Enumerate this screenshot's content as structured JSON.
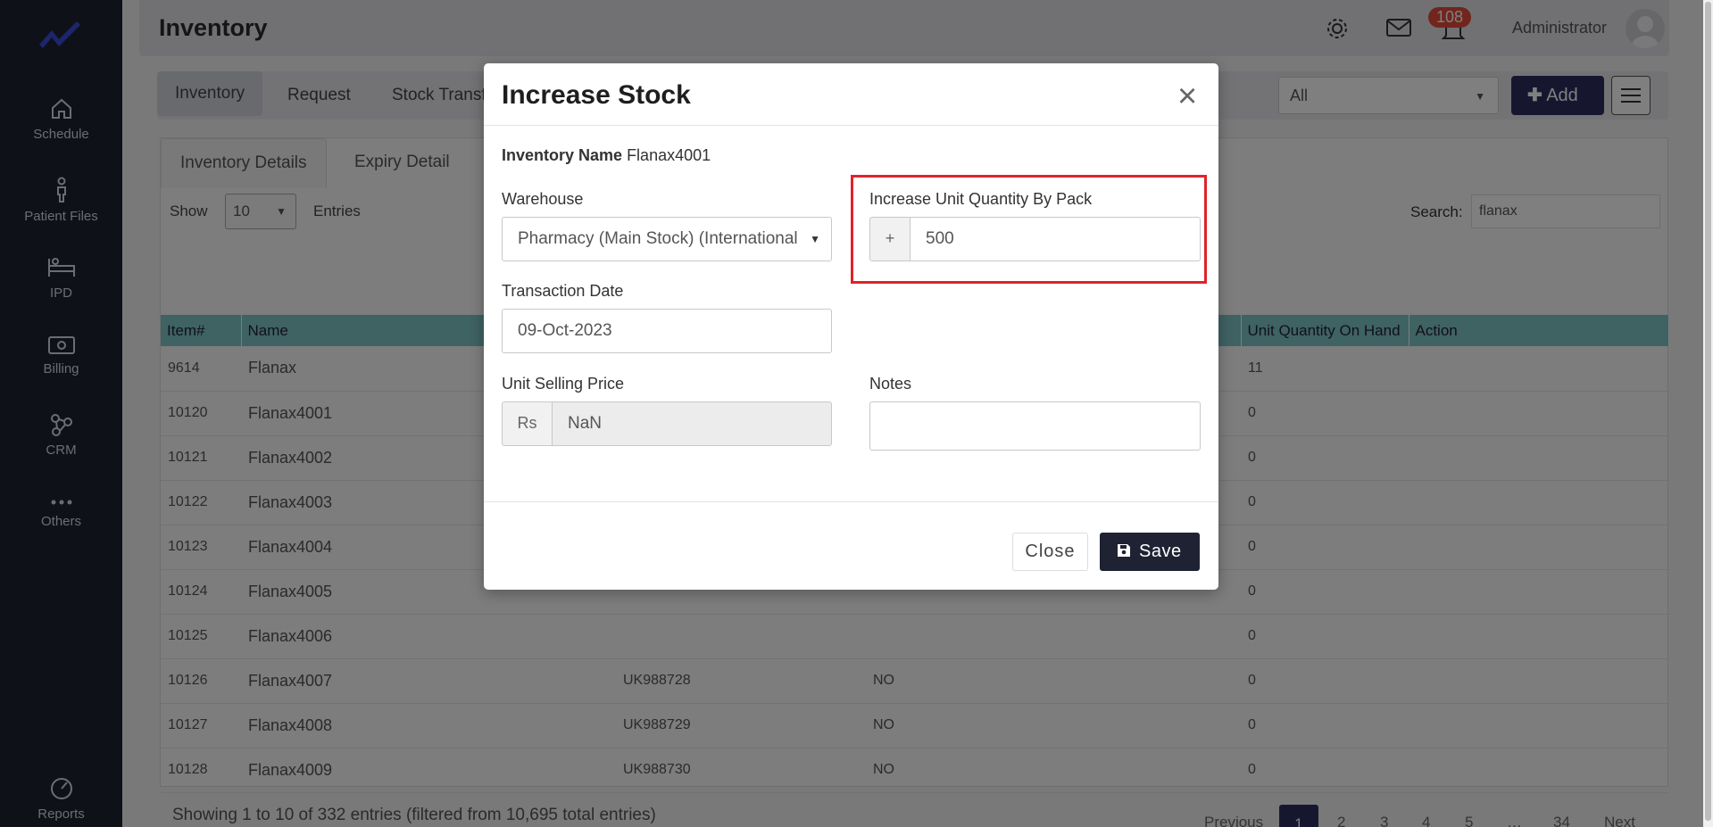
{
  "sidebar": {
    "items": [
      {
        "label": "Schedule",
        "icon": "home-icon"
      },
      {
        "label": "Patient Files",
        "icon": "person-icon"
      },
      {
        "label": "IPD",
        "icon": "bed-icon"
      },
      {
        "label": "Billing",
        "icon": "money-icon"
      },
      {
        "label": "CRM",
        "icon": "network-icon"
      },
      {
        "label": "Others",
        "icon": "more-icon"
      },
      {
        "label": "Reports",
        "icon": "chart-pie-icon"
      }
    ]
  },
  "header": {
    "title": "Inventory",
    "notification_count": "108",
    "user": "Administrator"
  },
  "tabs": [
    "Inventory",
    "Request",
    "Stock Transf"
  ],
  "filter": {
    "value": "All"
  },
  "add_label": "Add",
  "subtabs": [
    "Inventory Details",
    "Expiry Detail"
  ],
  "show": {
    "label": "Show",
    "value": "10",
    "suffix": "Entries"
  },
  "search": {
    "label": "Search:",
    "value": "flanax"
  },
  "table": {
    "columns": [
      "Item#",
      "Name",
      "Unit Quantity On Hand",
      "Action"
    ],
    "rows": [
      {
        "item": "9614",
        "name": "Flanax",
        "code": "",
        "flag": "",
        "qty": "11"
      },
      {
        "item": "10120",
        "name": "Flanax4001",
        "code": "",
        "flag": "",
        "qty": "0"
      },
      {
        "item": "10121",
        "name": "Flanax4002",
        "code": "",
        "flag": "",
        "qty": "0"
      },
      {
        "item": "10122",
        "name": "Flanax4003",
        "code": "",
        "flag": "",
        "qty": "0"
      },
      {
        "item": "10123",
        "name": "Flanax4004",
        "code": "",
        "flag": "",
        "qty": "0"
      },
      {
        "item": "10124",
        "name": "Flanax4005",
        "code": "",
        "flag": "",
        "qty": "0"
      },
      {
        "item": "10125",
        "name": "Flanax4006",
        "code": "",
        "flag": "",
        "qty": "0"
      },
      {
        "item": "10126",
        "name": "Flanax4007",
        "code": "UK988728",
        "flag": "NO",
        "qty": "0"
      },
      {
        "item": "10127",
        "name": "Flanax4008",
        "code": "UK988729",
        "flag": "NO",
        "qty": "0"
      },
      {
        "item": "10128",
        "name": "Flanax4009",
        "code": "UK988730",
        "flag": "NO",
        "qty": "0"
      }
    ],
    "footer": "Showing 1 to 10 of 332 entries (filtered from 10,695 total entries)"
  },
  "pagination": {
    "previous": "Previous",
    "pages": [
      "1",
      "2",
      "3",
      "4",
      "5",
      "…",
      "34"
    ],
    "next": "Next"
  },
  "modal": {
    "title": "Increase Stock",
    "inventory_name_label": "Inventory Name",
    "inventory_name_value": "Flanax4001",
    "warehouse_label": "Warehouse",
    "warehouse_value": "Pharmacy (Main Stock) (International",
    "increase_label": "Increase Unit Quantity By Pack",
    "increase_addon": "+",
    "increase_value": "500",
    "date_label": "Transaction Date",
    "date_value": "09-Oct-2023",
    "price_label": "Unit Selling Price",
    "price_addon": "Rs",
    "price_value": "NaN",
    "notes_label": "Notes",
    "notes_value": "",
    "close_label": "Close",
    "save_label": "Save"
  },
  "colors": {
    "sidebar": "#1f2233",
    "accent": "#2d2f5e",
    "table_header": "#7fc4c6",
    "highlight": "#e0232a",
    "badge": "#e24b3b"
  }
}
